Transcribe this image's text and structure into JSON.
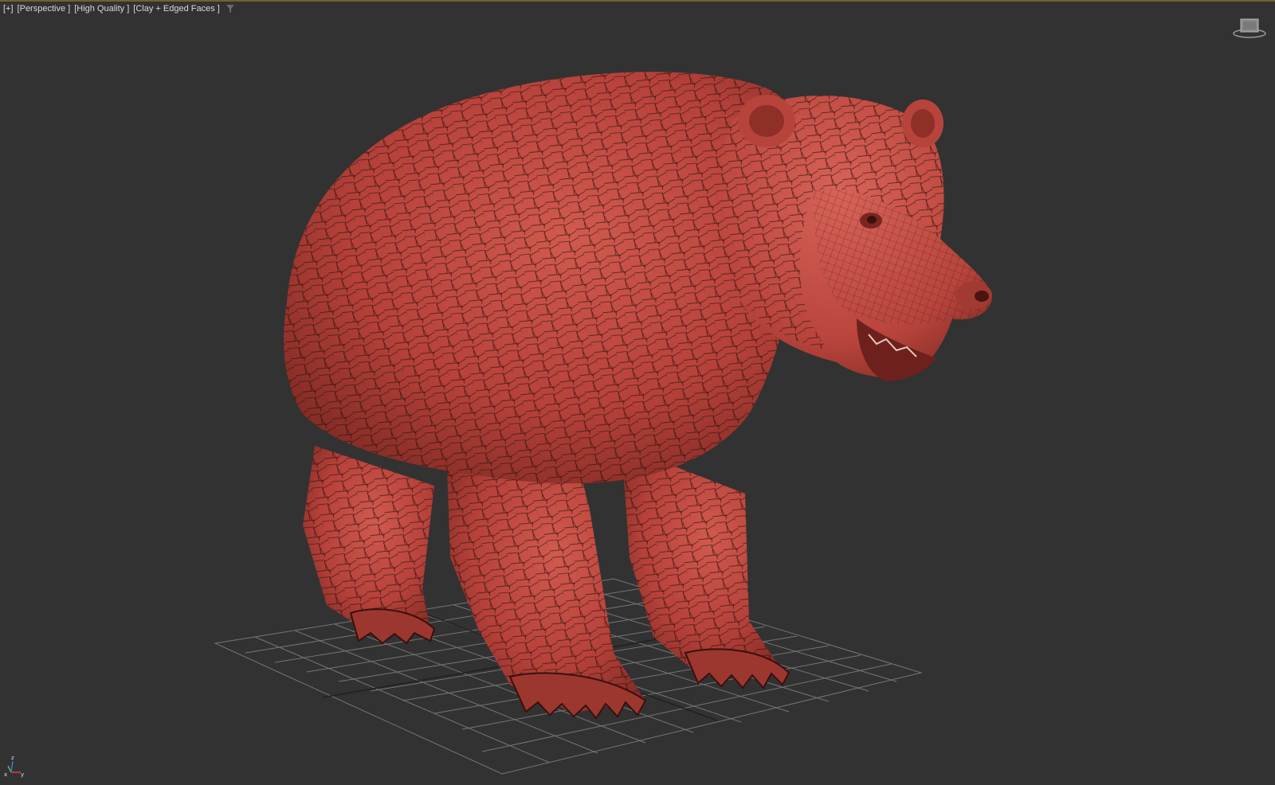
{
  "viewport": {
    "labels": {
      "menu": "[+]",
      "view": "[Perspective ]",
      "quality": "[High Quality ]",
      "shading": "[Clay + Edged Faces ]"
    },
    "icons": {
      "filter": "filter-funnel-icon",
      "viewcube": "viewcube-icon",
      "axis": "axis-tripod-icon"
    },
    "axis_labels": {
      "x": "x",
      "y": "y",
      "z": "z"
    }
  },
  "colors": {
    "background": "#323232",
    "accent": "#6b6432",
    "model": "#c0473c",
    "model_dark": "#8a2d25",
    "grid": "#9a9a9a",
    "axis_x": "#e0403a",
    "axis_y": "#4fbf4f",
    "axis_z": "#4a6fe0"
  }
}
